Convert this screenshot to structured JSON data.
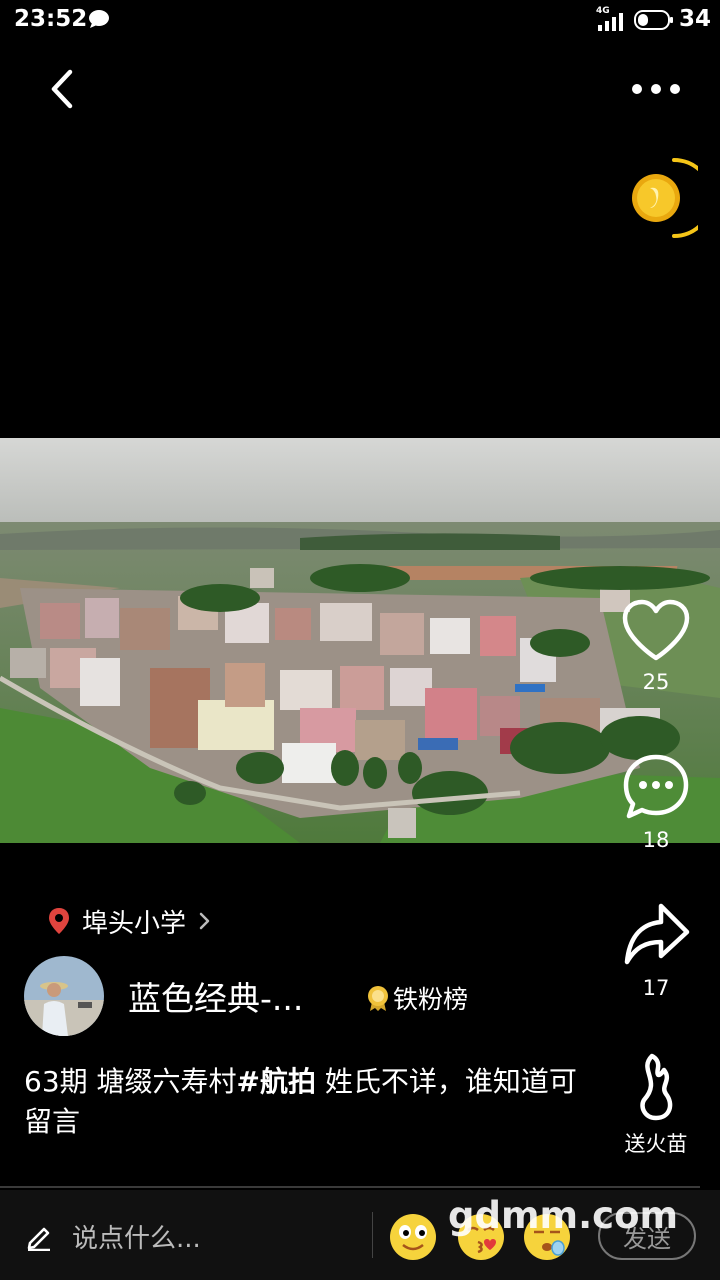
{
  "status_bar": {
    "time": "23:52",
    "network": "4G",
    "battery": "34"
  },
  "icons": {
    "back": "chevron-left-icon",
    "more": "more-dots-icon",
    "coin": "gold-coin-icon",
    "like": "heart-icon",
    "comment": "comment-bubble-icon",
    "share": "share-arrow-icon",
    "gift": "flame-icon",
    "location": "location-pin-icon",
    "fan_badge": "medal-icon",
    "edit": "pencil-icon"
  },
  "post": {
    "location": "埠头小学",
    "author": "蓝色经典-...",
    "fan_badge": "铁粉榜",
    "caption_prefix": "63期 塘缀六寿村",
    "caption_tag": "#航拍",
    "caption_suffix": " 姓氏不详，谁知道可留言"
  },
  "actions": {
    "likes": "25",
    "comments": "18",
    "shares": "17",
    "gift_label": "送火苗"
  },
  "comment_bar": {
    "placeholder": "说点什么...",
    "send_label": "发送"
  },
  "watermark": "gdmm.com",
  "colors": {
    "background": "#000000",
    "coin": "#f5c518",
    "pin": "#e0443e"
  }
}
